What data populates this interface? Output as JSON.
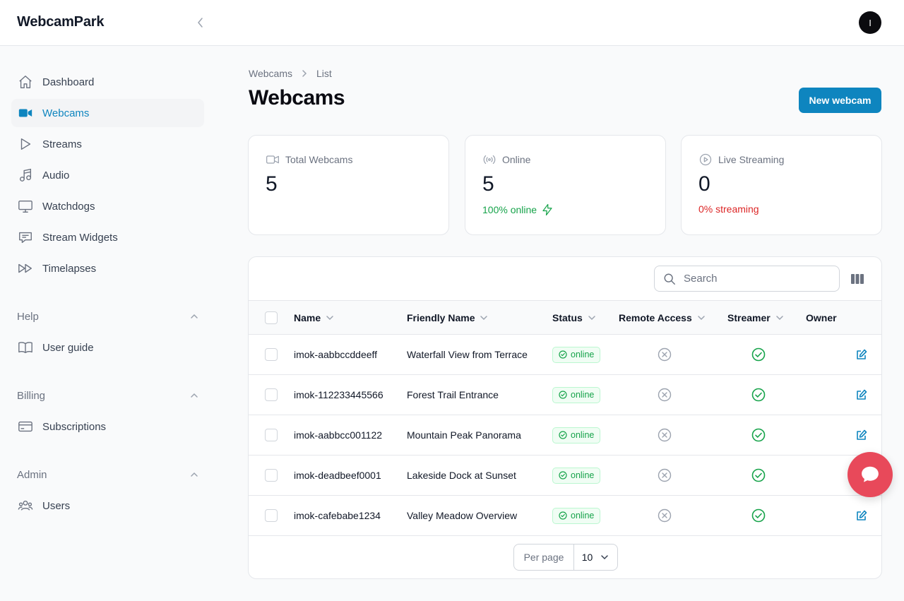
{
  "app": {
    "brand": "WebcamPark",
    "avatar_initial": "I"
  },
  "sidebar": {
    "items": [
      {
        "label": "Dashboard",
        "icon": "home-icon"
      },
      {
        "label": "Webcams",
        "icon": "video-camera-icon",
        "active": true
      },
      {
        "label": "Streams",
        "icon": "play-icon"
      },
      {
        "label": "Audio",
        "icon": "music-note-icon"
      },
      {
        "label": "Watchdogs",
        "icon": "monitor-icon"
      },
      {
        "label": "Stream Widgets",
        "icon": "chat-bubble-icon"
      },
      {
        "label": "Timelapses",
        "icon": "forward-icon"
      }
    ],
    "groups": [
      {
        "label": "Help",
        "items": [
          {
            "label": "User guide",
            "icon": "book-icon"
          }
        ]
      },
      {
        "label": "Billing",
        "items": [
          {
            "label": "Subscriptions",
            "icon": "credit-card-icon"
          }
        ]
      },
      {
        "label": "Admin",
        "items": [
          {
            "label": "Users",
            "icon": "users-icon"
          }
        ]
      }
    ]
  },
  "breadcrumb": {
    "parent": "Webcams",
    "current": "List"
  },
  "page": {
    "title": "Webcams",
    "new_button": "New webcam"
  },
  "stats": [
    {
      "label": "Total Webcams",
      "value": "5",
      "description": "",
      "icon": "video-camera-icon"
    },
    {
      "label": "Online",
      "value": "5",
      "description": "100% online",
      "color": "#16a34a",
      "icon": "signal-icon"
    },
    {
      "label": "Live Streaming",
      "value": "0",
      "description": "0% streaming",
      "color": "#dc2626",
      "icon": "play-circle-icon"
    }
  ],
  "table": {
    "search_placeholder": "Search",
    "columns": [
      "Name",
      "Friendly Name",
      "Status",
      "Remote Access",
      "Streamer",
      "Owner"
    ],
    "rows": [
      {
        "name": "imok-aabbccddeeff",
        "friendly_name": "Waterfall View from Terrace",
        "status": "online",
        "remote_access": false,
        "streamer": true
      },
      {
        "name": "imok-112233445566",
        "friendly_name": "Forest Trail Entrance",
        "status": "online",
        "remote_access": false,
        "streamer": true
      },
      {
        "name": "imok-aabbcc001122",
        "friendly_name": "Mountain Peak Panorama",
        "status": "online",
        "remote_access": false,
        "streamer": true
      },
      {
        "name": "imok-deadbeef0001",
        "friendly_name": "Lakeside Dock at Sunset",
        "status": "online",
        "remote_access": false,
        "streamer": true
      },
      {
        "name": "imok-cafebabe1234",
        "friendly_name": "Valley Meadow Overview",
        "status": "online",
        "remote_access": false,
        "streamer": true
      }
    ],
    "pagination": {
      "per_page_label": "Per page",
      "per_page_value": "10"
    }
  },
  "colors": {
    "accent": "#0e85bf",
    "success": "#16a34a",
    "danger": "#dc2626",
    "chat": "#e8495a"
  }
}
